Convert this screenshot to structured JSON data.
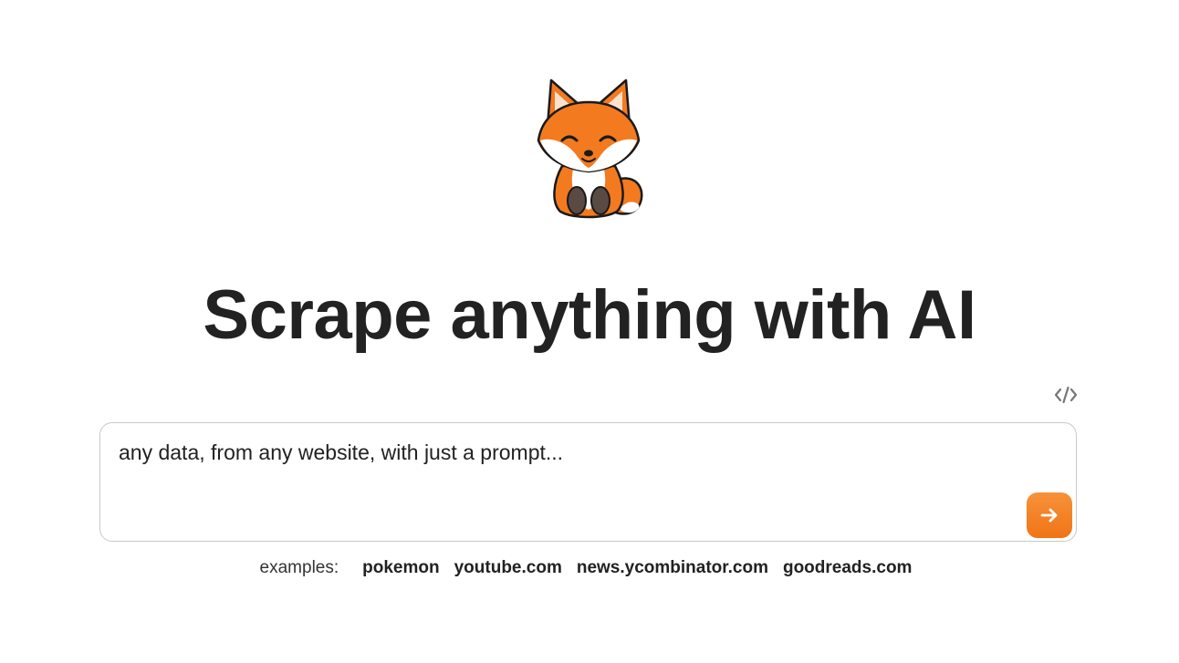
{
  "hero": {
    "logo_icon": "fox-mascot-icon",
    "title": "Scrape anything with AI"
  },
  "toolbar": {
    "code_toggle_icon": "code-brackets-icon",
    "code_toggle_glyph": "</>"
  },
  "prompt": {
    "placeholder": "any data, from any website, with just a prompt...",
    "value": "",
    "submit_icon": "arrow-right-icon",
    "accent_color": "#f07416"
  },
  "examples": {
    "label": "examples:",
    "items": [
      {
        "label": "pokemon"
      },
      {
        "label": "youtube.com"
      },
      {
        "label": "news.ycombinator.com"
      },
      {
        "label": "goodreads.com"
      }
    ]
  }
}
